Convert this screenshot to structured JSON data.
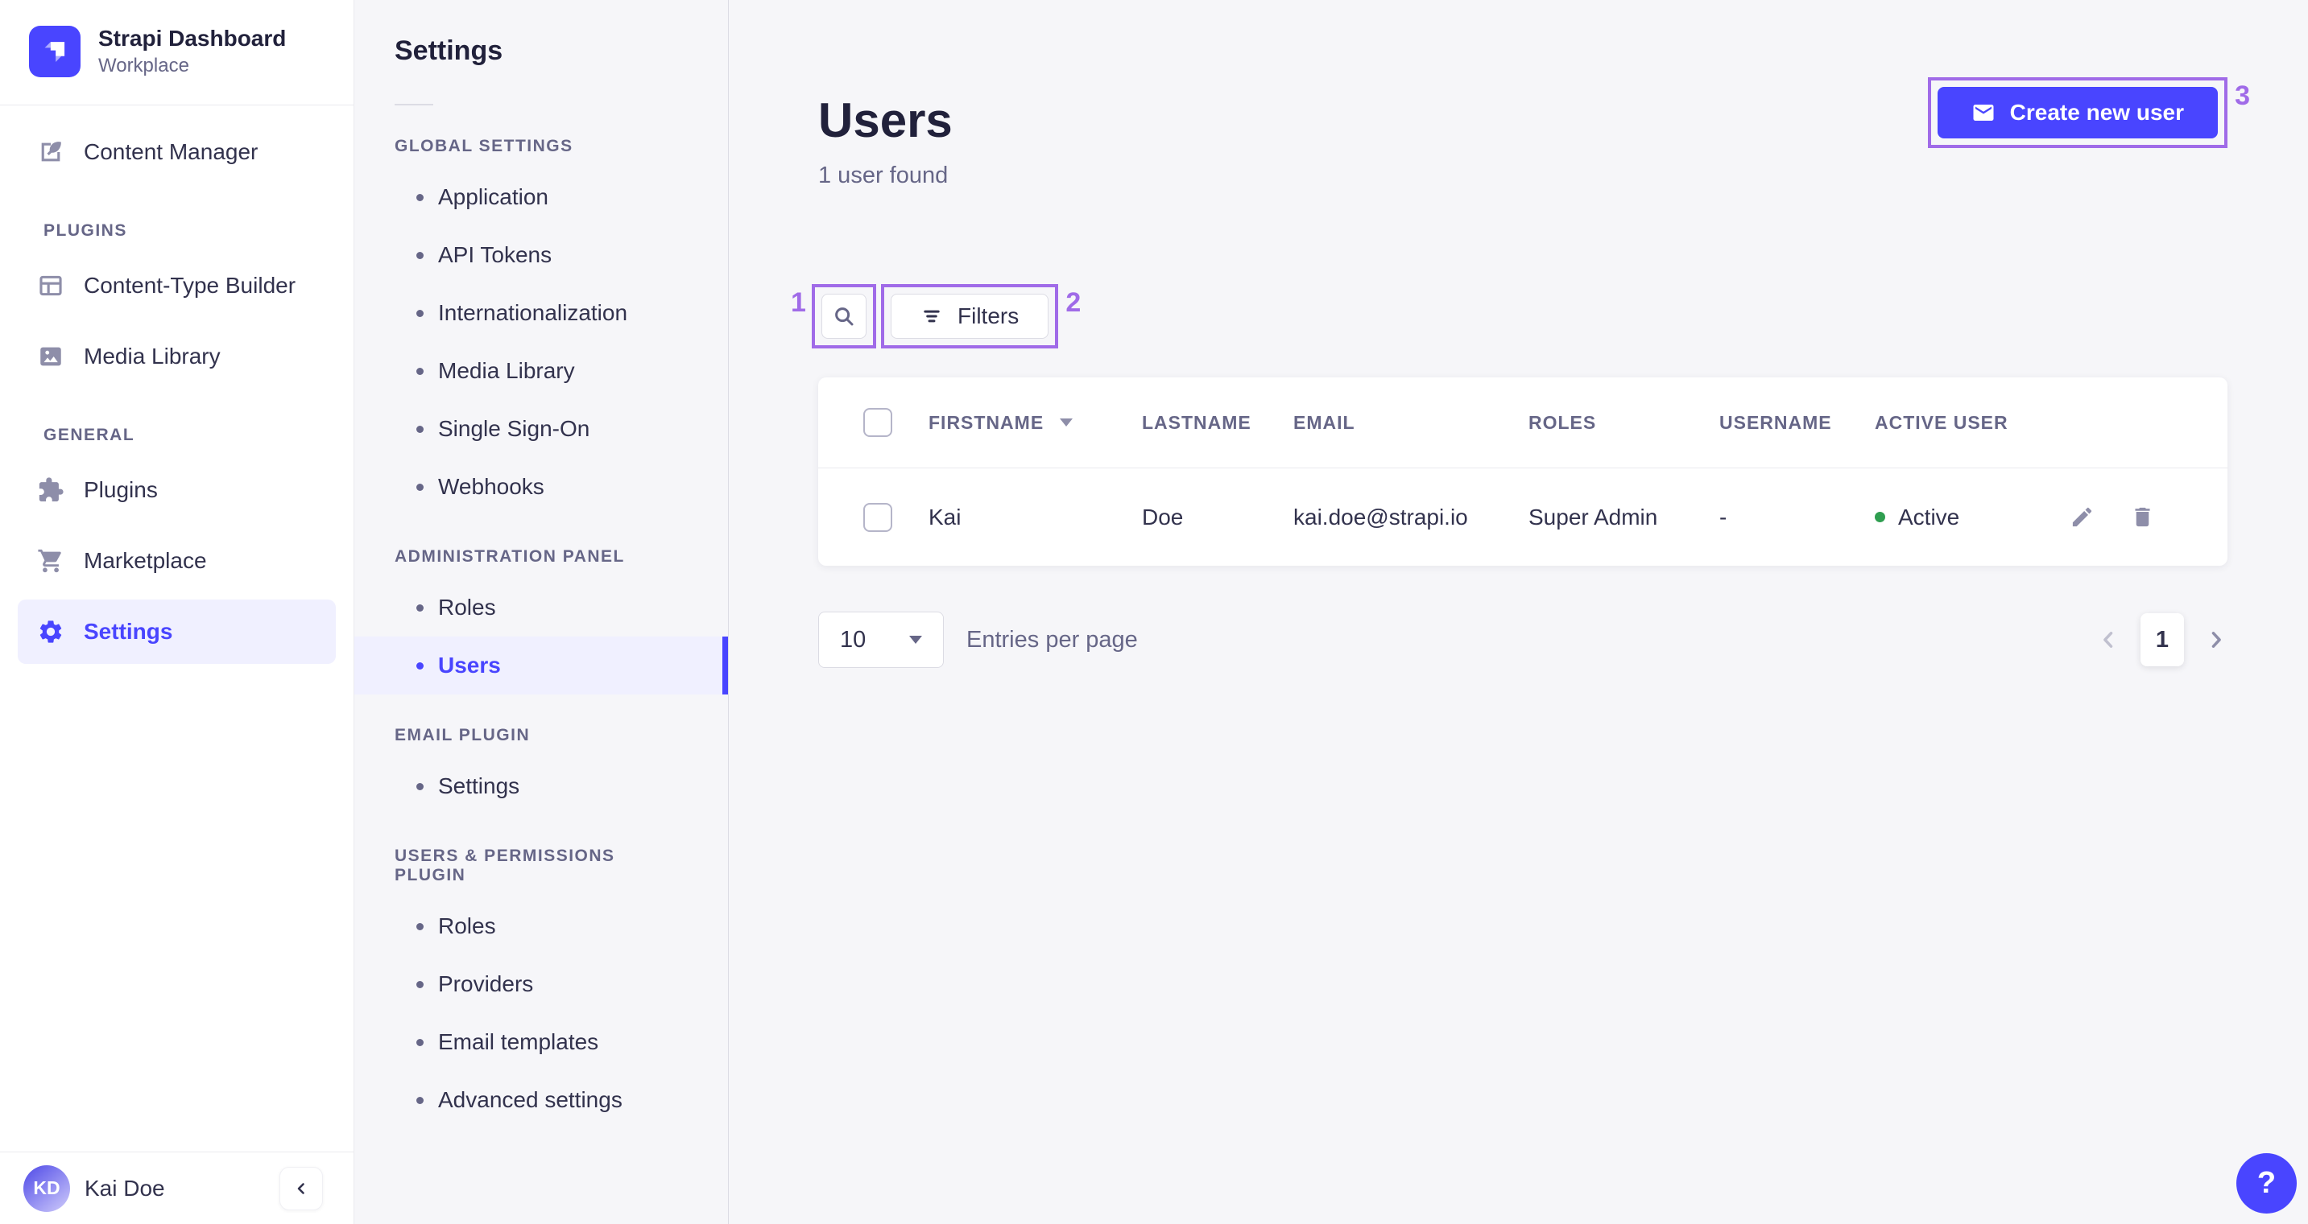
{
  "brand": {
    "title": "Strapi Dashboard",
    "subtitle": "Workplace",
    "logo_icon": "strapi-logo-icon"
  },
  "sidebar": {
    "content_manager": {
      "label": "Content Manager",
      "icon": "feather-pen-icon"
    },
    "sections": [
      {
        "label": "PLUGINS",
        "items": [
          {
            "label": "Content-Type Builder",
            "icon": "layout-icon"
          },
          {
            "label": "Media Library",
            "icon": "image-icon"
          }
        ]
      },
      {
        "label": "GENERAL",
        "items": [
          {
            "label": "Plugins",
            "icon": "puzzle-icon"
          },
          {
            "label": "Marketplace",
            "icon": "cart-icon"
          },
          {
            "label": "Settings",
            "icon": "gear-icon",
            "active": true
          }
        ]
      }
    ],
    "user": {
      "initials": "KD",
      "name": "Kai Doe"
    },
    "collapse_icon": "chevron-left-icon"
  },
  "subnav": {
    "title": "Settings",
    "sections": [
      {
        "label": "GLOBAL SETTINGS",
        "items": [
          "Application",
          "API Tokens",
          "Internationalization",
          "Media Library",
          "Single Sign-On",
          "Webhooks"
        ]
      },
      {
        "label": "ADMINISTRATION PANEL",
        "items": [
          "Roles",
          "Users"
        ],
        "active_item": "Users"
      },
      {
        "label": "EMAIL PLUGIN",
        "items": [
          "Settings"
        ]
      },
      {
        "label": "USERS & PERMISSIONS PLUGIN",
        "items": [
          "Roles",
          "Providers",
          "Email templates",
          "Advanced settings"
        ]
      }
    ]
  },
  "main": {
    "title": "Users",
    "subtitle": "1 user found",
    "create_button": {
      "label": "Create new user",
      "icon": "envelope-icon"
    },
    "search_icon": "search-icon",
    "filters_button": {
      "label": "Filters",
      "icon": "filter-icon"
    },
    "table": {
      "headers": [
        "FIRSTNAME",
        "LASTNAME",
        "EMAIL",
        "ROLES",
        "USERNAME",
        "ACTIVE USER"
      ],
      "sorted_by": "FIRSTNAME",
      "rows": [
        {
          "firstname": "Kai",
          "lastname": "Doe",
          "email": "kai.doe@strapi.io",
          "roles": "Super Admin",
          "username": "-",
          "active": "Active",
          "row_icons": [
            "pencil-icon",
            "trash-icon"
          ]
        }
      ]
    },
    "pagination": {
      "page_size": "10",
      "entries_label": "Entries per page",
      "current_page": "1"
    },
    "help_label": "?"
  },
  "annotations": [
    "1",
    "2",
    "3"
  ],
  "colors": {
    "primary": "#4945ff",
    "primary_bg": "#f0f0ff",
    "annotation": "#a06be8",
    "success_dot": "#2f9e50",
    "text_dark": "#32324d",
    "text_mid": "#666687",
    "background": "#f6f6f9"
  }
}
